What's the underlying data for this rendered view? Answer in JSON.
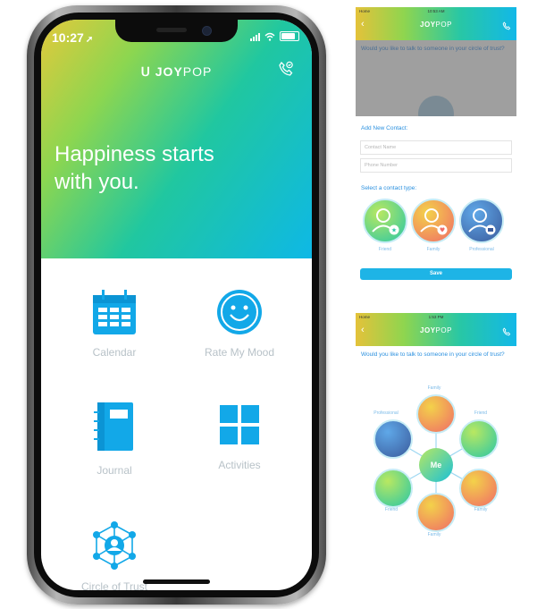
{
  "phone": {
    "status_time": "10:27",
    "brand": "JOYPOP",
    "brand_bold": "JOY",
    "brand_thin": "POP",
    "tagline": "Happiness starts with you.",
    "tiles": [
      {
        "label": "Calendar",
        "icon": "calendar-icon"
      },
      {
        "label": "Rate My Mood",
        "icon": "smiley-icon"
      },
      {
        "label": "Journal",
        "icon": "journal-icon"
      },
      {
        "label": "Activities",
        "icon": "activities-grid-icon"
      },
      {
        "label": "Circle of Trust",
        "icon": "circle-of-trust-icon"
      }
    ],
    "colors": {
      "gradient": [
        "#e3c93b",
        "#8cd650",
        "#20c7a0",
        "#0eb8e6"
      ],
      "accent": "#12a8e8"
    }
  },
  "add_contact_screen": {
    "carrier": "Home",
    "time": "10:53 AM",
    "brand_bold": "JOY",
    "brand_thin": "POP",
    "question": "Would you like to talk to someone in your circle of trust?",
    "section_title": "Add New Contact:",
    "name_placeholder": "Contact Name",
    "phone_placeholder": "Phone Number",
    "type_label": "Select a contact type:",
    "types": [
      {
        "label": "Friend",
        "badge": "star"
      },
      {
        "label": "Family",
        "badge": "heart"
      },
      {
        "label": "Professional",
        "badge": "briefcase"
      }
    ],
    "save_label": "Save"
  },
  "circle_screen": {
    "carrier": "Home",
    "time": "1:53 PM",
    "brand_bold": "JOY",
    "brand_thin": "POP",
    "question": "Would you like to talk to someone in your circle of trust?",
    "center_label": "Me",
    "nodes": [
      {
        "label": "Family"
      },
      {
        "label": "Friend"
      },
      {
        "label": "Family"
      },
      {
        "label": "Family"
      },
      {
        "label": "Friend"
      },
      {
        "label": "Professional"
      }
    ]
  }
}
